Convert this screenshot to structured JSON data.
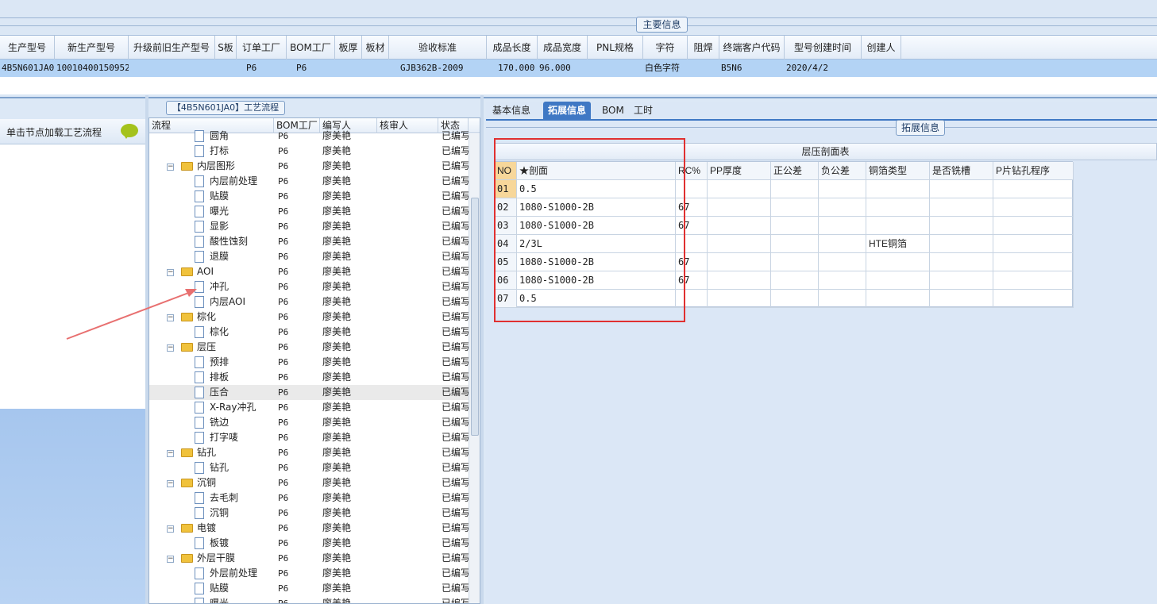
{
  "header": {
    "section_label": "主要信息"
  },
  "main_grid": {
    "columns": [
      "生产型号",
      "新生产型号",
      "升级前旧生产型号",
      "S板",
      "订单工厂",
      "BOM工厂",
      "板厚",
      "板材",
      "验收标准",
      "成品长度",
      "成品宽度",
      "PNL规格",
      "字符",
      "阻焊",
      "终端客户代码",
      "型号创建时间",
      "创建人"
    ],
    "row": {
      "c0": "4B5N601JA0",
      "c1": "10010400150952",
      "c2": "",
      "c3": "",
      "c4": "P6",
      "c5": "P6",
      "c6": "",
      "c7": "",
      "c8": "GJB362B-2009",
      "c9": "170.000",
      "c10": "96.000",
      "c11": "",
      "c12": "白色字符",
      "c13": "",
      "c14": "B5N6",
      "c15": "2020/4/2",
      "c16": ""
    }
  },
  "left_panel": {
    "load_button": "单击节点加载工艺流程"
  },
  "flow": {
    "title": "【4B5N601JA0】工艺流程",
    "columns": [
      "流程",
      "BOM工厂",
      "编写人",
      "核审人",
      "状态"
    ],
    "rows": [
      {
        "t": "doc",
        "label": "圆角",
        "f": "P6",
        "w": "廖美艳",
        "s": "已编写"
      },
      {
        "t": "doc",
        "label": "打标",
        "f": "P6",
        "w": "廖美艳",
        "s": "已编写"
      },
      {
        "t": "folder",
        "label": "内层图形",
        "f": "P6",
        "w": "廖美艳",
        "s": "已编写"
      },
      {
        "t": "doc",
        "label": "内层前处理",
        "f": "P6",
        "w": "廖美艳",
        "s": "已编写"
      },
      {
        "t": "doc",
        "label": "贴膜",
        "f": "P6",
        "w": "廖美艳",
        "s": "已编写"
      },
      {
        "t": "doc",
        "label": "曝光",
        "f": "P6",
        "w": "廖美艳",
        "s": "已编写"
      },
      {
        "t": "doc",
        "label": "显影",
        "f": "P6",
        "w": "廖美艳",
        "s": "已编写"
      },
      {
        "t": "doc",
        "label": "酸性蚀刻",
        "f": "P6",
        "w": "廖美艳",
        "s": "已编写"
      },
      {
        "t": "doc",
        "label": "退膜",
        "f": "P6",
        "w": "廖美艳",
        "s": "已编写"
      },
      {
        "t": "folder",
        "label": "AOI",
        "f": "P6",
        "w": "廖美艳",
        "s": "已编写"
      },
      {
        "t": "doc",
        "label": "冲孔",
        "f": "P6",
        "w": "廖美艳",
        "s": "已编写"
      },
      {
        "t": "doc",
        "label": "内层AOI",
        "f": "P6",
        "w": "廖美艳",
        "s": "已编写"
      },
      {
        "t": "folder",
        "label": "棕化",
        "f": "P6",
        "w": "廖美艳",
        "s": "已编写"
      },
      {
        "t": "doc",
        "label": "棕化",
        "f": "P6",
        "w": "廖美艳",
        "s": "已编写"
      },
      {
        "t": "folder",
        "label": "层压",
        "f": "P6",
        "w": "廖美艳",
        "s": "已编写"
      },
      {
        "t": "doc",
        "label": "预排",
        "f": "P6",
        "w": "廖美艳",
        "s": "已编写"
      },
      {
        "t": "doc",
        "label": "排板",
        "f": "P6",
        "w": "廖美艳",
        "s": "已编写"
      },
      {
        "t": "doc",
        "label": "压合",
        "f": "P6",
        "w": "廖美艳",
        "s": "已编写",
        "sel": true
      },
      {
        "t": "doc",
        "label": "X-Ray冲孔",
        "f": "P6",
        "w": "廖美艳",
        "s": "已编写"
      },
      {
        "t": "doc",
        "label": "铣边",
        "f": "P6",
        "w": "廖美艳",
        "s": "已编写"
      },
      {
        "t": "doc",
        "label": "打字唛",
        "f": "P6",
        "w": "廖美艳",
        "s": "已编写"
      },
      {
        "t": "folder",
        "label": "钻孔",
        "f": "P6",
        "w": "廖美艳",
        "s": "已编写"
      },
      {
        "t": "doc",
        "label": "钻孔",
        "f": "P6",
        "w": "廖美艳",
        "s": "已编写"
      },
      {
        "t": "folder",
        "label": "沉铜",
        "f": "P6",
        "w": "廖美艳",
        "s": "已编写"
      },
      {
        "t": "doc",
        "label": "去毛刺",
        "f": "P6",
        "w": "廖美艳",
        "s": "已编写"
      },
      {
        "t": "doc",
        "label": "沉铜",
        "f": "P6",
        "w": "廖美艳",
        "s": "已编写"
      },
      {
        "t": "folder",
        "label": "电镀",
        "f": "P6",
        "w": "廖美艳",
        "s": "已编写"
      },
      {
        "t": "doc",
        "label": "板镀",
        "f": "P6",
        "w": "廖美艳",
        "s": "已编写"
      },
      {
        "t": "folder",
        "label": "外层干膜",
        "f": "P6",
        "w": "廖美艳",
        "s": "已编写"
      },
      {
        "t": "doc",
        "label": "外层前处理",
        "f": "P6",
        "w": "廖美艳",
        "s": "已编写"
      },
      {
        "t": "doc",
        "label": "贴膜",
        "f": "P6",
        "w": "廖美艳",
        "s": "已编写"
      },
      {
        "t": "doc",
        "label": "曝光",
        "f": "P6",
        "w": "廖美艳",
        "s": "已编写"
      }
    ]
  },
  "tabs": [
    "基本信息",
    "拓展信息",
    "BOM",
    "工时"
  ],
  "active_tab": 1,
  "ext": {
    "legend": "拓展信息",
    "table_title": "层压剖面表",
    "columns": [
      "NO",
      "★剖面",
      "RC%",
      "PP厚度",
      "正公差",
      "负公差",
      "铜箔类型",
      "是否铣槽",
      "P片钻孔程序"
    ],
    "rows": [
      [
        "01",
        "0.5",
        "",
        "",
        "",
        "",
        "",
        "",
        ""
      ],
      [
        "02",
        "1080-S1000-2B",
        "67",
        "",
        "",
        "",
        "",
        "",
        ""
      ],
      [
        "03",
        "1080-S1000-2B",
        "67",
        "",
        "",
        "",
        "",
        "",
        ""
      ],
      [
        "04",
        "2/3L",
        "",
        "",
        "",
        "",
        "HTE铜箔",
        "",
        ""
      ],
      [
        "05",
        "1080-S1000-2B",
        "67",
        "",
        "",
        "",
        "",
        "",
        ""
      ],
      [
        "06",
        "1080-S1000-2B",
        "67",
        "",
        "",
        "",
        "",
        "",
        ""
      ],
      [
        "07",
        "0.5",
        "",
        "",
        "",
        "",
        "",
        "",
        ""
      ]
    ]
  },
  "colors": {
    "highlight_box": "#e03030",
    "arrow": "#e87070",
    "tab_active": "#3f78c4",
    "selected_row": "#b3d3f5"
  }
}
